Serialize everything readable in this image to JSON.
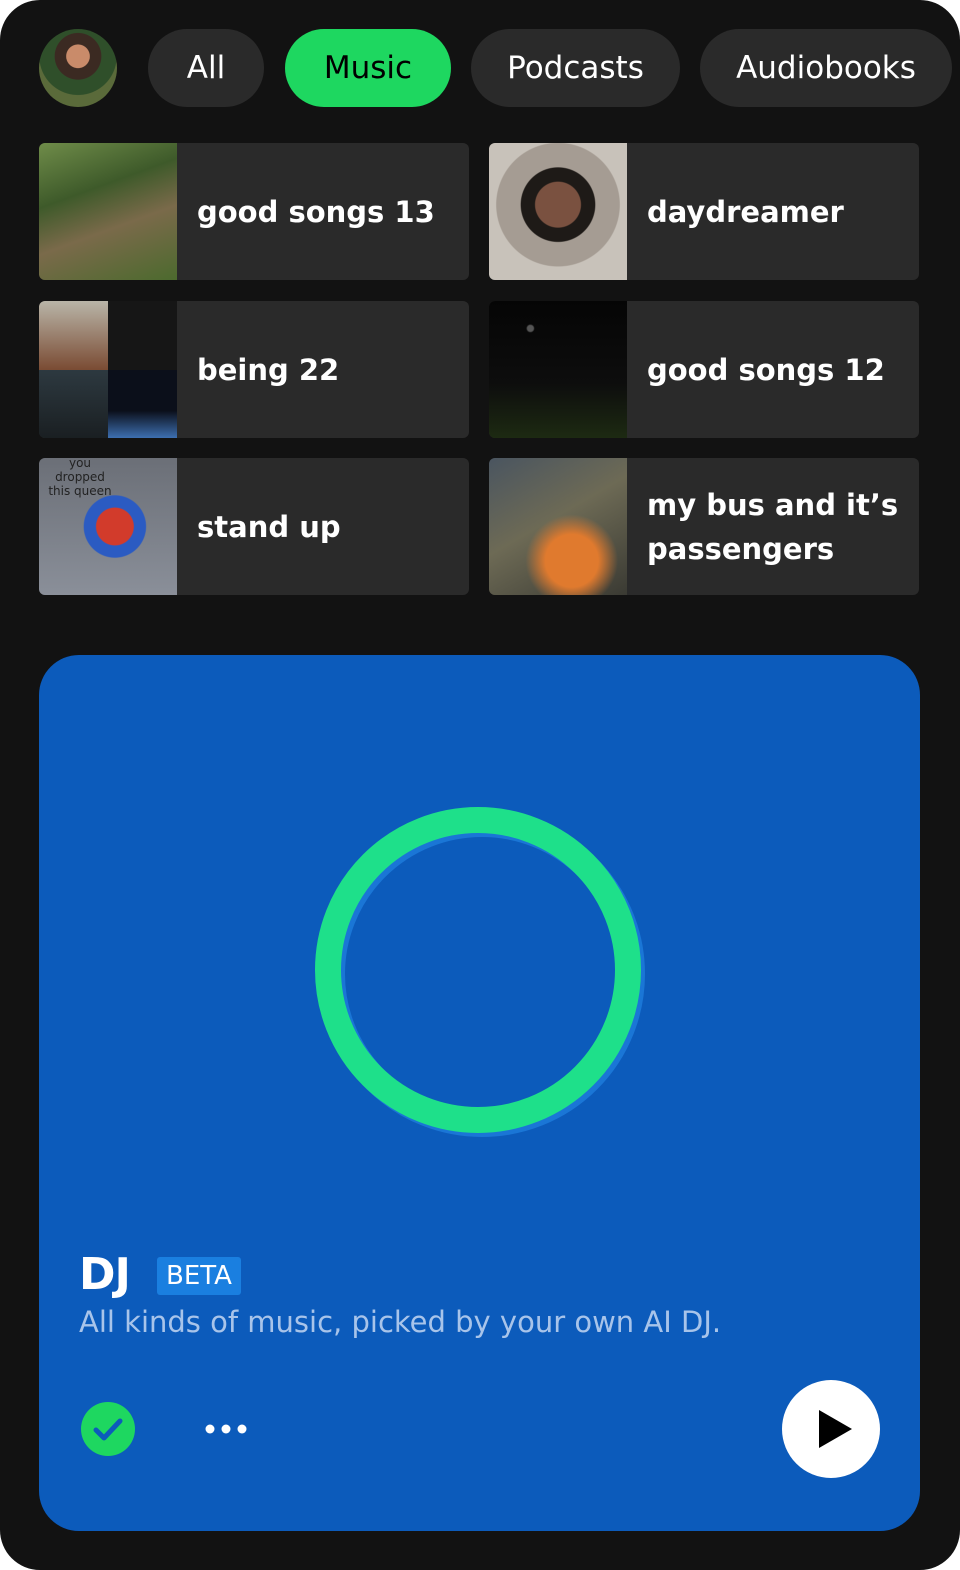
{
  "filters": {
    "chips": [
      {
        "label": "All",
        "selected": false
      },
      {
        "label": "Music",
        "selected": true
      },
      {
        "label": "Podcasts",
        "selected": false
      },
      {
        "label": "Audiobooks",
        "selected": false
      }
    ]
  },
  "shortcuts": [
    {
      "title": "good songs 13"
    },
    {
      "title": "daydreamer"
    },
    {
      "title": "being 22"
    },
    {
      "title": "good songs 12"
    },
    {
      "title": "stand up",
      "art_text": "you dropped this queen"
    },
    {
      "title": "my bus and it’s passengers"
    }
  ],
  "dj_card": {
    "title": "DJ",
    "badge": "BETA",
    "subtitle": "All kinds of music, picked by your own AI DJ."
  },
  "icons": {
    "check": "check-circle-icon",
    "more": "more-horizontal-icon",
    "play": "play-icon"
  },
  "colors": {
    "accent": "#1ed760",
    "dj_background": "#0c5bbb",
    "ring": "#1ee08a",
    "app_background": "#121212",
    "chip_background": "#2a2a2a"
  }
}
